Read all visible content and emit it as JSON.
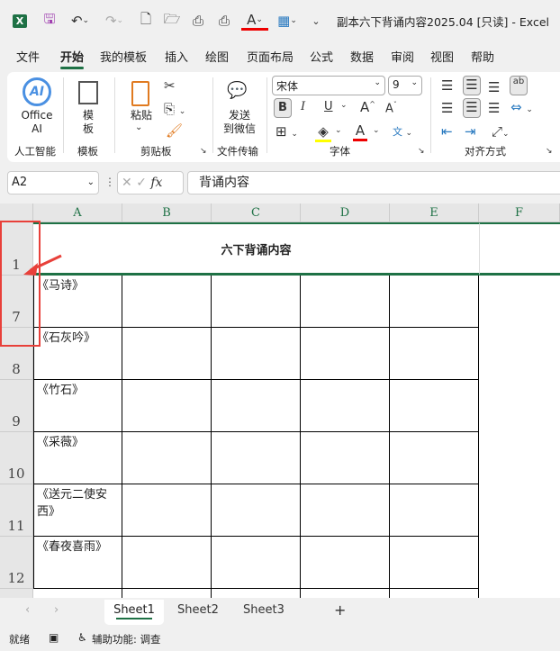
{
  "title_bar": {
    "title": "副本六下背诵内容2025.04  [只读]  -  Excel"
  },
  "menu": [
    "文件",
    "开始",
    "我的模板",
    "插入",
    "绘图",
    "页面布局",
    "公式",
    "数据",
    "审阅",
    "视图",
    "帮助"
  ],
  "ribbon": {
    "office_ai": "Office\nAI",
    "office_ai_l1": "Office",
    "office_ai_l2": "AI",
    "ai_group": "人工智能",
    "template_l1": "模",
    "template_l2": "板",
    "template_group": "模板",
    "paste": "粘贴",
    "clipboard_group": "剪贴板",
    "send_l1": "发送",
    "send_l2": "到微信",
    "transfer_group": "文件传输",
    "font_name": "宋体",
    "font_size": "9",
    "bold": "B",
    "italic": "I",
    "underline": "U",
    "font_group": "字体",
    "align_group": "对齐方式"
  },
  "formula_bar": {
    "name_box": "A2",
    "fx": "fx",
    "value": "背诵内容"
  },
  "columns": [
    "A",
    "B",
    "C",
    "D",
    "E",
    "F"
  ],
  "title_row": {
    "row": "1",
    "text": "六下背诵内容"
  },
  "rows": [
    {
      "num": "7",
      "a": "《马诗》"
    },
    {
      "num": "8",
      "a": "《石灰吟》"
    },
    {
      "num": "9",
      "a": "《竹石》"
    },
    {
      "num": "10",
      "a": "《采薇》"
    },
    {
      "num": "11",
      "a": "《送元二使安西》"
    },
    {
      "num": "12",
      "a": "《春夜喜雨》"
    }
  ],
  "sheets": [
    "Sheet1",
    "Sheet2",
    "Sheet3"
  ],
  "active_sheet": "Sheet1",
  "status": {
    "ready": "就绪",
    "accessibility": "辅助功能: 调查"
  },
  "colors": {
    "accent": "#1e7145",
    "annotation": "#e8403a"
  }
}
